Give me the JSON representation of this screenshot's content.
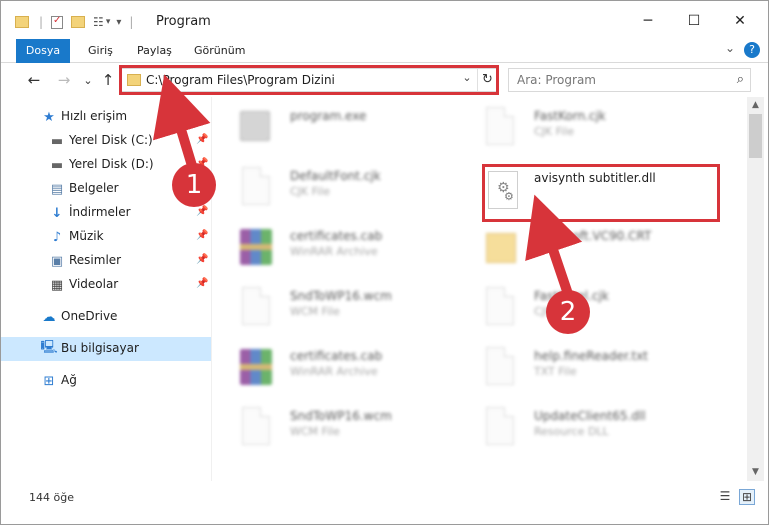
{
  "window": {
    "title": "Program",
    "minimize": "─",
    "maximize": "☐",
    "close": "✕"
  },
  "ribbon": {
    "tabs": [
      "Dosya",
      "Giriş",
      "Paylaş",
      "Görünüm"
    ],
    "expand": "⌄",
    "help": "?"
  },
  "nav": {
    "back": "←",
    "forward": "→",
    "recent": "⌄",
    "up": "↑",
    "address": "C:\\Program Files\\Program Dizini",
    "dropdown": "⌄",
    "refresh": "↻",
    "search_placeholder": "Ara: Program",
    "search_icon": "⌕"
  },
  "sidebar": {
    "items": [
      {
        "label": "Hızlı erişim",
        "icon": "star-icon",
        "pinned": false
      },
      {
        "label": "Yerel Disk (C:)",
        "icon": "drive-icon",
        "pinned": true
      },
      {
        "label": "Yerel Disk (D:)",
        "icon": "drive-icon",
        "pinned": true
      },
      {
        "label": "Belgeler",
        "icon": "documents-icon",
        "pinned": true
      },
      {
        "label": "İndirmeler",
        "icon": "download-icon",
        "pinned": true
      },
      {
        "label": "Müzik",
        "icon": "music-icon",
        "pinned": true
      },
      {
        "label": "Resimler",
        "icon": "pictures-icon",
        "pinned": true
      },
      {
        "label": "Videolar",
        "icon": "videos-icon",
        "pinned": true
      },
      {
        "label": "OneDrive",
        "icon": "cloud-icon",
        "pinned": false
      },
      {
        "label": "Bu bilgisayar",
        "icon": "computer-icon",
        "pinned": false,
        "selected": true
      },
      {
        "label": "Ağ",
        "icon": "network-icon",
        "pinned": false
      }
    ]
  },
  "files": {
    "left": [
      {
        "name": "program.exe",
        "type": "",
        "kind": "exe"
      },
      {
        "name": "DefaultFont.cjk",
        "type": "CJK File",
        "kind": "doc"
      },
      {
        "name": "certificates.cab",
        "type": "WinRAR Archive",
        "kind": "rar"
      },
      {
        "name": "SndToWP16.wcm",
        "type": "WCM File",
        "kind": "doc"
      },
      {
        "name": "certificates.cab",
        "type": "WinRAR Archive",
        "kind": "rar"
      },
      {
        "name": "SndToWP16.wcm",
        "type": "WCM File",
        "kind": "doc"
      }
    ],
    "right": [
      {
        "name": "FastKorn.cjk",
        "type": "CJK File",
        "kind": "doc"
      },
      {
        "name": "avisynth subtitler.dll",
        "type": "",
        "kind": "dll"
      },
      {
        "name": "Microsoft.VC90.CRT",
        "type": "",
        "kind": "folder"
      },
      {
        "name": "FastKorel.cjk",
        "type": "CJK File",
        "kind": "doc"
      },
      {
        "name": "help.fineReader.txt",
        "type": "TXT File",
        "kind": "doc"
      },
      {
        "name": "UpdateClient65.dll",
        "type": "Resource DLL",
        "kind": "doc"
      }
    ]
  },
  "status": {
    "count": "144 öğe"
  },
  "annotations": {
    "badge1": "1",
    "badge2": "2",
    "color": "#d7343a"
  },
  "colors": {
    "accent": "#1979ca",
    "selection": "#cce8ff",
    "highlight": "#d7343a"
  }
}
